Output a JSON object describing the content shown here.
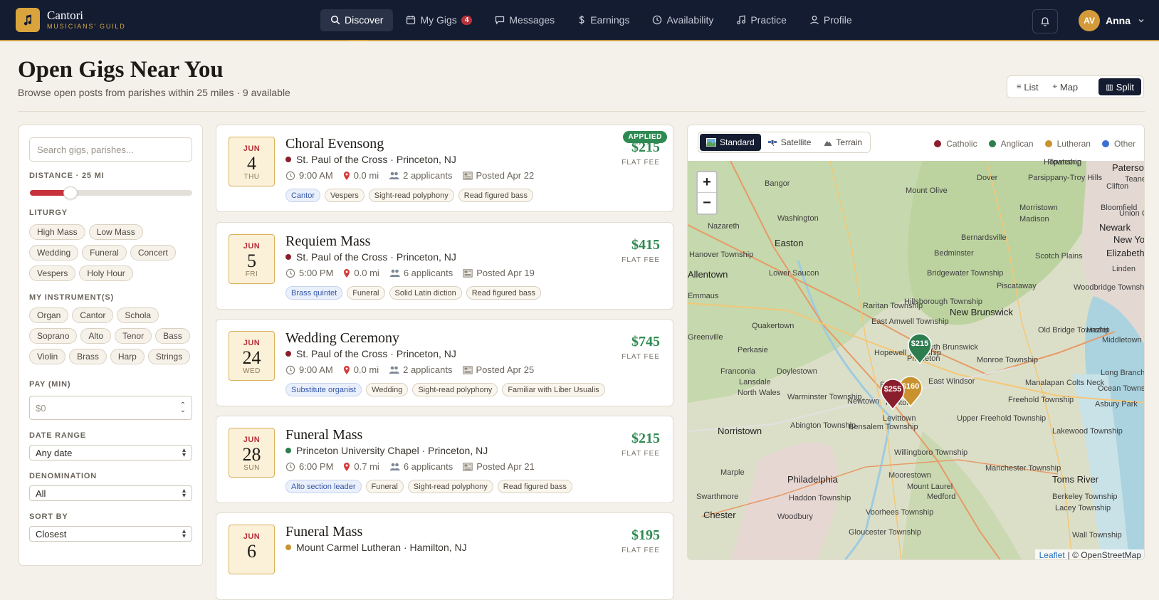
{
  "brand": {
    "name": "Cantori",
    "subtitle": "MUSICIANS' GUILD"
  },
  "nav": [
    {
      "label": "Discover",
      "icon": "search-icon",
      "active": true
    },
    {
      "label": "My Gigs",
      "icon": "calendar-icon",
      "badge": "4"
    },
    {
      "label": "Messages",
      "icon": "message-icon"
    },
    {
      "label": "Earnings",
      "icon": "dollar-icon"
    },
    {
      "label": "Availability",
      "icon": "clock-icon"
    },
    {
      "label": "Practice",
      "icon": "music-note-icon"
    },
    {
      "label": "Profile",
      "icon": "user-icon"
    }
  ],
  "user": {
    "initials": "AV",
    "name": "Anna"
  },
  "page": {
    "title": "Open Gigs Near You",
    "subtitle": "Browse open posts from parishes within 25 miles · 9 available"
  },
  "view_toggle": {
    "list": "List",
    "map": "Map",
    "split": "Split",
    "active": "Split"
  },
  "filters": {
    "search_placeholder": "Search gigs, parishes...",
    "distance_label": "DISTANCE · 25 MI",
    "distance_fraction": 0.25,
    "liturgy_label": "LITURGY",
    "liturgy": [
      "High Mass",
      "Low Mass",
      "Wedding",
      "Funeral",
      "Concert",
      "Vespers",
      "Holy Hour"
    ],
    "instruments_label": "MY INSTRUMENT(S)",
    "instruments": [
      "Organ",
      "Cantor",
      "Schola",
      "Soprano",
      "Alto",
      "Tenor",
      "Bass",
      "Violin",
      "Brass",
      "Harp",
      "Strings"
    ],
    "pay_label": "PAY (MIN)",
    "pay_placeholder": "$0",
    "date_label": "DATE RANGE",
    "date_value": "Any date",
    "denomination_label": "DENOMINATION",
    "denomination_value": "All",
    "sort_label": "SORT BY",
    "sort_value": "Closest"
  },
  "gigs": [
    {
      "mon": "JUN",
      "day": "4",
      "dow": "THU",
      "title": "Choral Evensong",
      "place": "St. Paul of the Cross · Princeton, NJ",
      "denom_color": "#8b1e2c",
      "time": "9:00 AM",
      "dist": "0.0 mi",
      "applicants": "2 applicants",
      "posted": "Posted Apr 22",
      "tags": [
        "Cantor",
        "Vespers",
        "Sight-read polyphony",
        "Read figured bass"
      ],
      "price": "$215",
      "fee": "FLAT FEE",
      "applied": "APPLIED"
    },
    {
      "mon": "JUN",
      "day": "5",
      "dow": "FRI",
      "title": "Requiem Mass",
      "place": "St. Paul of the Cross · Princeton, NJ",
      "denom_color": "#8b1e2c",
      "time": "5:00 PM",
      "dist": "0.0 mi",
      "applicants": "6 applicants",
      "posted": "Posted Apr 19",
      "tags": [
        "Brass quintet",
        "Funeral",
        "Solid Latin diction",
        "Read figured bass"
      ],
      "price": "$415",
      "fee": "FLAT FEE"
    },
    {
      "mon": "JUN",
      "day": "24",
      "dow": "WED",
      "title": "Wedding Ceremony",
      "place": "St. Paul of the Cross · Princeton, NJ",
      "denom_color": "#8b1e2c",
      "time": "9:00 AM",
      "dist": "0.0 mi",
      "applicants": "2 applicants",
      "posted": "Posted Apr 25",
      "tags": [
        "Substitute organist",
        "Wedding",
        "Sight-read polyphony",
        "Familiar with Liber Usualis"
      ],
      "price": "$745",
      "fee": "FLAT FEE"
    },
    {
      "mon": "JUN",
      "day": "28",
      "dow": "SUN",
      "title": "Funeral Mass",
      "place": "Princeton University Chapel · Princeton, NJ",
      "denom_color": "#2e7d4f",
      "time": "6:00 PM",
      "dist": "0.7 mi",
      "applicants": "6 applicants",
      "posted": "Posted Apr 21",
      "tags": [
        "Alto section leader",
        "Funeral",
        "Sight-read polyphony",
        "Read figured bass"
      ],
      "price": "$215",
      "fee": "FLAT FEE"
    },
    {
      "mon": "JUN",
      "day": "6",
      "dow": "",
      "title": "Funeral Mass",
      "place": "Mount Carmel Lutheran · Hamilton, NJ",
      "denom_color": "#c9922e",
      "time": "",
      "dist": "",
      "applicants": "",
      "posted": "",
      "tags": [],
      "price": "$195",
      "fee": "FLAT FEE"
    }
  ],
  "map": {
    "tabs": [
      "Standard",
      "Satellite",
      "Terrain"
    ],
    "active_tab": "Standard",
    "legend": [
      {
        "label": "Catholic",
        "color": "#8b1e2c"
      },
      {
        "label": "Anglican",
        "color": "#2e7d4f"
      },
      {
        "label": "Lutheran",
        "color": "#c9922e"
      },
      {
        "label": "Other",
        "color": "#3b6fd1"
      }
    ],
    "pins": [
      {
        "label": "$215",
        "color": "#2e7d4f"
      },
      {
        "label": "$160",
        "color": "#c9922e"
      },
      {
        "label": "$255",
        "color": "#8b1e2c"
      }
    ],
    "zoom_in": "+",
    "zoom_out": "−",
    "attribution_leaflet": "Leaflet",
    "attribution_rest": "| © OpenStreetMap",
    "places": [
      "Hopatcong",
      "Dover",
      "Parsippany-Troy Hills",
      "Paterson",
      "Teaneck",
      "Township",
      "Clifton",
      "Bangor",
      "Mount Olive",
      "Morristown",
      "Bloomfield",
      "Union City",
      "Washington",
      "Madison",
      "Newark",
      "New York",
      "Nazareth",
      "Bernardsville",
      "Easton",
      "Bedminster",
      "Scotch Plains",
      "Elizabeth",
      "Hanover Township",
      "Linden",
      "Allentown",
      "Lower Saucon",
      "Bridgewater Township",
      "Piscataway",
      "Woodbridge Township",
      "Emmaus",
      "Hillsborough Township",
      "Raritan Township",
      "New Brunswick",
      "East Amwell Township",
      "Old Bridge Township",
      "Hazlet",
      "Quakertown",
      "Middletown Township",
      "Greenville",
      "South Brunswick",
      "Perkasie",
      "Hopewell Township",
      "Princeton",
      "Monroe Township",
      "Long Branch",
      "Franconia",
      "Doylestown",
      "East Windsor",
      "Lansdale",
      "Ewing",
      "Manalapan",
      "Colts Neck",
      "Ocean Township",
      "North Wales",
      "Warminster Township",
      "Newtown",
      "Trenton",
      "Freehold Township",
      "Asbury Park",
      "Levittown",
      "Upper Freehold Township",
      "Norristown",
      "Abington Township",
      "Bensalem Township",
      "Lakewood Township",
      "Willingboro Township",
      "Manchester Township",
      "Marple",
      "Philadelphia",
      "Moorestown",
      "Mount Laurel",
      "Toms River",
      "Swarthmore",
      "Haddon Township",
      "Medford",
      "Berkeley Township",
      "Chester",
      "Woodbury",
      "Voorhees Township",
      "Lacey Township",
      "Gloucester Township",
      "Wall Township"
    ]
  }
}
